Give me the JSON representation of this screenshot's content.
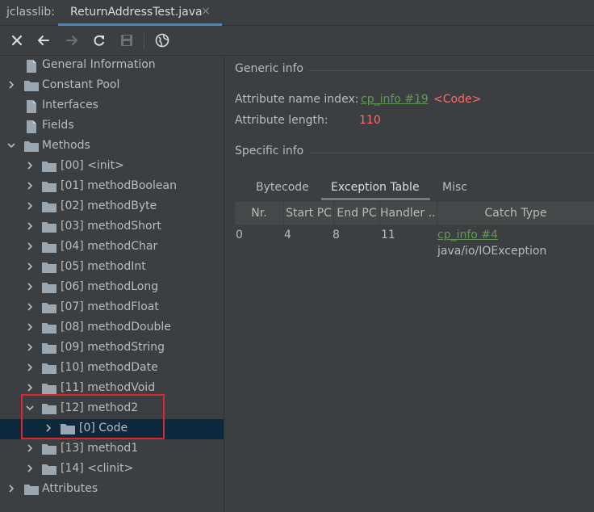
{
  "topbar": {
    "tool_title": "jclasslib:",
    "tab_label": "ReturnAddressTest.java",
    "tab_close": "×"
  },
  "toolbar": {
    "buttons": [
      {
        "name": "close-icon"
      },
      {
        "name": "back-arrow-icon"
      },
      {
        "name": "forward-arrow-icon"
      },
      {
        "name": "refresh-icon"
      },
      {
        "name": "save-icon"
      },
      {
        "name": "globe-icon"
      }
    ]
  },
  "tree": {
    "general_information": "General Information",
    "constant_pool": "Constant Pool",
    "interfaces": "Interfaces",
    "fields": "Fields",
    "methods": "Methods",
    "method_items": [
      "[00] <init>",
      "[01] methodBoolean",
      "[02] methodByte",
      "[03] methodShort",
      "[04] methodChar",
      "[05] methodInt",
      "[06] methodLong",
      "[07] methodFloat",
      "[08] methodDouble",
      "[09] methodString",
      "[10] methodDate",
      "[11] methodVoid",
      "[12] method2"
    ],
    "code_item": "[0] Code",
    "method_items_after": [
      "[13] method1",
      "[14] <clinit>"
    ],
    "attributes": "Attributes"
  },
  "generic": {
    "title": "Generic info",
    "name_index_label": "Attribute name index:",
    "name_index_link": "cp_info #19",
    "name_index_value": "<Code>",
    "length_label": "Attribute length:",
    "length_value": "110"
  },
  "specific": {
    "title": "Specific info",
    "tabs": [
      "Bytecode",
      "Exception Table",
      "Misc"
    ],
    "active_tab": "Exception Table",
    "columns": [
      "Nr.",
      "Start PC",
      "End PC",
      "Handler ...",
      "Catch Type"
    ],
    "rows": [
      {
        "nr": "0",
        "start_pc": "4",
        "end_pc": "8",
        "handler": "11",
        "catch_link": "cp_info #4",
        "catch_type": "java/io/IOException"
      }
    ]
  },
  "colors": {
    "background": "#3c3f41",
    "selection": "#0d293e",
    "highlight_box": "#e0252b",
    "link_green": "#629755",
    "value_red": "#ff6b68",
    "tab_underline": "#4a88c7"
  }
}
